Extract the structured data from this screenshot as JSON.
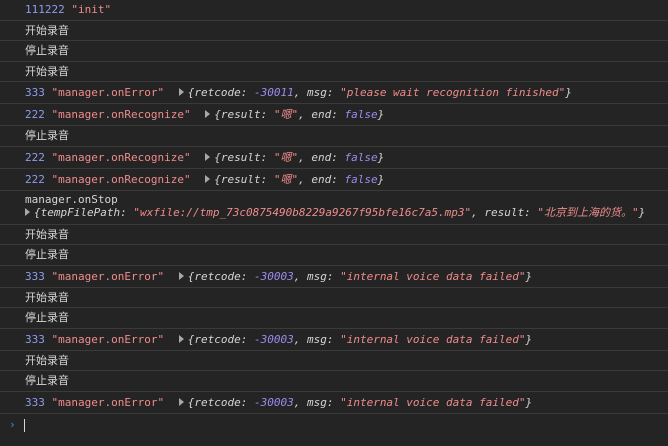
{
  "rows": [
    {
      "num": "111222",
      "str": "\"init\""
    },
    {
      "text": "开始录音"
    },
    {
      "text": "停止录音"
    },
    {
      "text": "开始录音"
    },
    {
      "num": "333",
      "str": "\"manager.onError\"",
      "obj": {
        "k1": "retcode",
        "v1": "-30011",
        "k2": "msg",
        "v2": "\"please wait recognition finished\""
      }
    },
    {
      "num": "222",
      "str": "\"manager.onRecognize\"",
      "obj": {
        "k1": "result",
        "v1": "\"嗯\"",
        "k2": "end",
        "v2": "false"
      }
    },
    {
      "text": "停止录音"
    },
    {
      "num": "222",
      "str": "\"manager.onRecognize\"",
      "obj": {
        "k1": "result",
        "v1": "\"嗯\"",
        "k2": "end",
        "v2": "false"
      }
    },
    {
      "num": "222",
      "str": "\"manager.onRecognize\"",
      "obj": {
        "k1": "result",
        "v1": "\"嗯\"",
        "k2": "end",
        "v2": "false"
      }
    },
    {
      "label": "manager.onStop",
      "obj": {
        "k1": "tempFilePath",
        "v1": "\"wxfile://tmp_73c0875490b8229a9267f95bfe16c7a5.mp3\"",
        "k2": "result",
        "v2": "\"北京到上海的货。\""
      }
    },
    {
      "text": "开始录音"
    },
    {
      "text": "停止录音"
    },
    {
      "num": "333",
      "str": "\"manager.onError\"",
      "obj": {
        "k1": "retcode",
        "v1": "-30003",
        "k2": "msg",
        "v2": "\"internal voice data failed\""
      }
    },
    {
      "text": "开始录音"
    },
    {
      "text": "停止录音"
    },
    {
      "num": "333",
      "str": "\"manager.onError\"",
      "obj": {
        "k1": "retcode",
        "v1": "-30003",
        "k2": "msg",
        "v2": "\"internal voice data failed\""
      }
    },
    {
      "text": "开始录音"
    },
    {
      "text": "停止录音"
    },
    {
      "num": "333",
      "str": "\"manager.onError\"",
      "obj": {
        "k1": "retcode",
        "v1": "-30003",
        "k2": "msg",
        "v2": "\"internal voice data failed\""
      }
    }
  ],
  "prompt": {
    "caret": "›",
    "value": ""
  }
}
